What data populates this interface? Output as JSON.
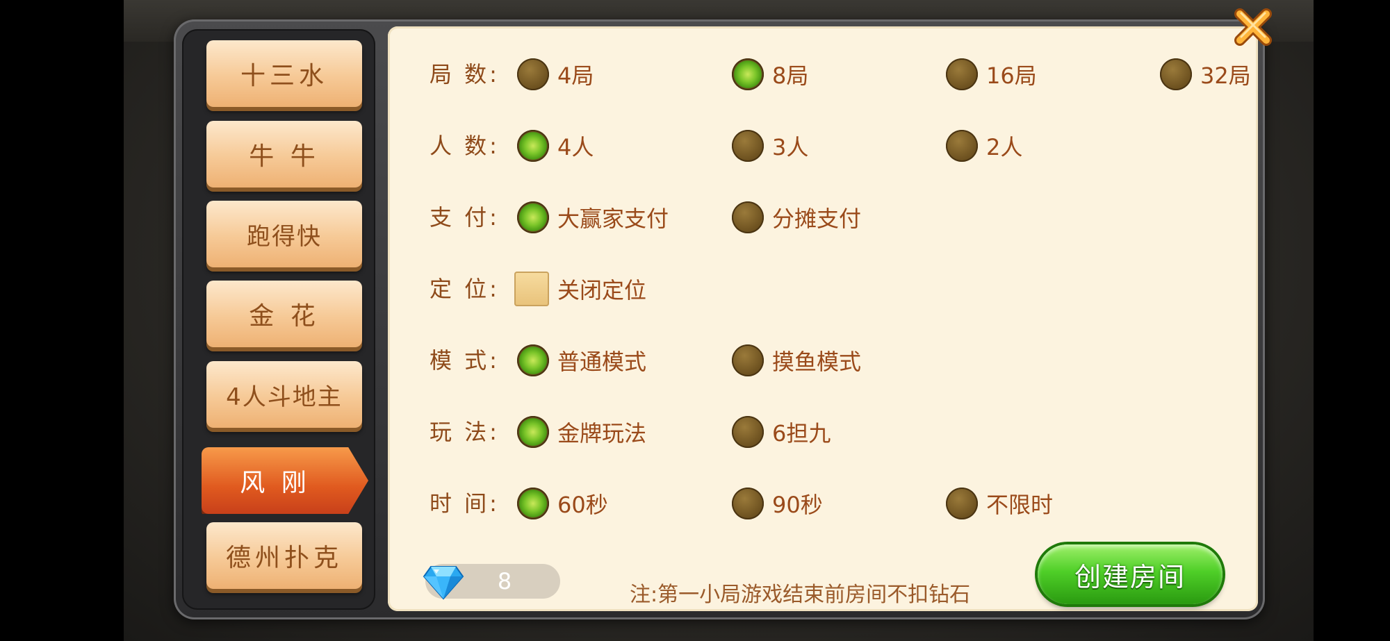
{
  "sidebar": {
    "items": [
      {
        "label": "十三水",
        "active": false
      },
      {
        "label": "牛 牛",
        "active": false
      },
      {
        "label": "跑得快",
        "active": false
      },
      {
        "label": "金 花",
        "active": false
      },
      {
        "label": "4人斗地主",
        "active": false
      },
      {
        "label": "风 刚",
        "active": true
      },
      {
        "label": "德州扑克",
        "active": false
      }
    ]
  },
  "settings": {
    "rounds": {
      "label": "局 数:",
      "options": [
        "4局",
        "8局",
        "16局",
        "32局"
      ],
      "selected": "8局"
    },
    "players": {
      "label": "人 数:",
      "options": [
        "4人",
        "3人",
        "2人"
      ],
      "selected": "4人"
    },
    "payment": {
      "label": "支 付:",
      "options": [
        "大赢家支付",
        "分摊支付"
      ],
      "selected": "大赢家支付"
    },
    "location": {
      "label": "定 位:",
      "checkbox_label": "关闭定位",
      "checked": false
    },
    "mode": {
      "label": "模 式:",
      "options": [
        "普通模式",
        "摸鱼模式"
      ],
      "selected": "普通模式"
    },
    "gameplay": {
      "label": "玩 法:",
      "options": [
        "金牌玩法",
        "6担九"
      ],
      "selected": "金牌玩法"
    },
    "time": {
      "label": "时 间:",
      "options": [
        "60秒",
        "90秒",
        "不限时"
      ],
      "selected": "60秒"
    }
  },
  "footer": {
    "diamond_count": "8",
    "note": "注:第一小局游戏结束前房间不扣钻石",
    "create_label": "创建房间"
  },
  "icons": {
    "close": "close-icon",
    "diamond": "diamond-icon"
  },
  "colors": {
    "accent_orange": "#e05a1f",
    "selected_green": "#4fcf28",
    "text_brown": "#8e4a1a",
    "panel_bg": "#fcf3df"
  }
}
